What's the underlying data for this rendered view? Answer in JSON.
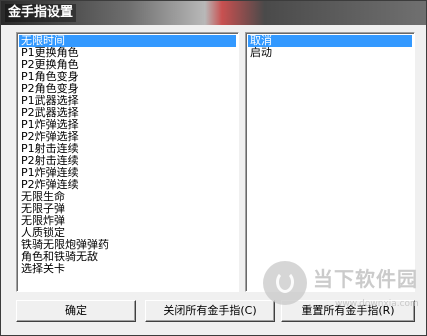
{
  "window": {
    "title": "金手指设置"
  },
  "left_list": {
    "items": [
      {
        "label": "无限时间",
        "selected": true
      },
      {
        "label": "P1更换角色"
      },
      {
        "label": "P2更换角色"
      },
      {
        "label": "P1角色变身"
      },
      {
        "label": "P2角色变身"
      },
      {
        "label": "P1武器选择"
      },
      {
        "label": "P2武器选择"
      },
      {
        "label": "P1炸弹选择"
      },
      {
        "label": "P2炸弹选择"
      },
      {
        "label": "P1射击连续"
      },
      {
        "label": "P2射击连续"
      },
      {
        "label": "P1炸弹连续"
      },
      {
        "label": "P2炸弹连续"
      },
      {
        "label": "无限生命"
      },
      {
        "label": "无限子弹"
      },
      {
        "label": "无限炸弹"
      },
      {
        "label": "人质锁定"
      },
      {
        "label": "铁骑无限炮弹弹药"
      },
      {
        "label": "角色和铁骑无敌"
      },
      {
        "label": "选择关卡"
      }
    ]
  },
  "right_list": {
    "items": [
      {
        "label": "取消",
        "selected": true
      },
      {
        "label": "启动"
      }
    ]
  },
  "buttons": {
    "ok": "确定",
    "close_all": "关闭所有金手指(C)",
    "reset_all": "重置所有金手指(R)"
  },
  "watermark": {
    "text": "当下软件园",
    "sub": "www.downxia.com"
  },
  "colors": {
    "selection": "#3399ff",
    "face": "#f0f0f0"
  }
}
